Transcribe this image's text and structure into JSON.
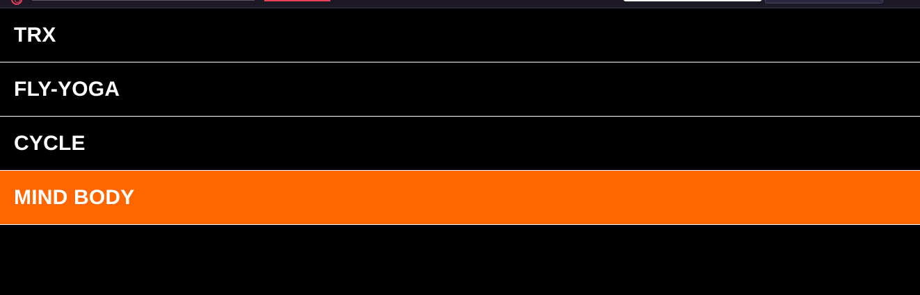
{
  "menu": {
    "items": [
      {
        "label": "TRX",
        "active": false
      },
      {
        "label": "FLY-YOGA",
        "active": false
      },
      {
        "label": "CYCLE",
        "active": false
      },
      {
        "label": "MIND BODY",
        "active": true
      }
    ]
  },
  "colors": {
    "background": "#000000",
    "text": "#ffffff",
    "active": "#ff6600",
    "divider": "#ffffff",
    "accent": "#e8435a"
  },
  "icons": {
    "logo": "circle-logo-icon"
  }
}
